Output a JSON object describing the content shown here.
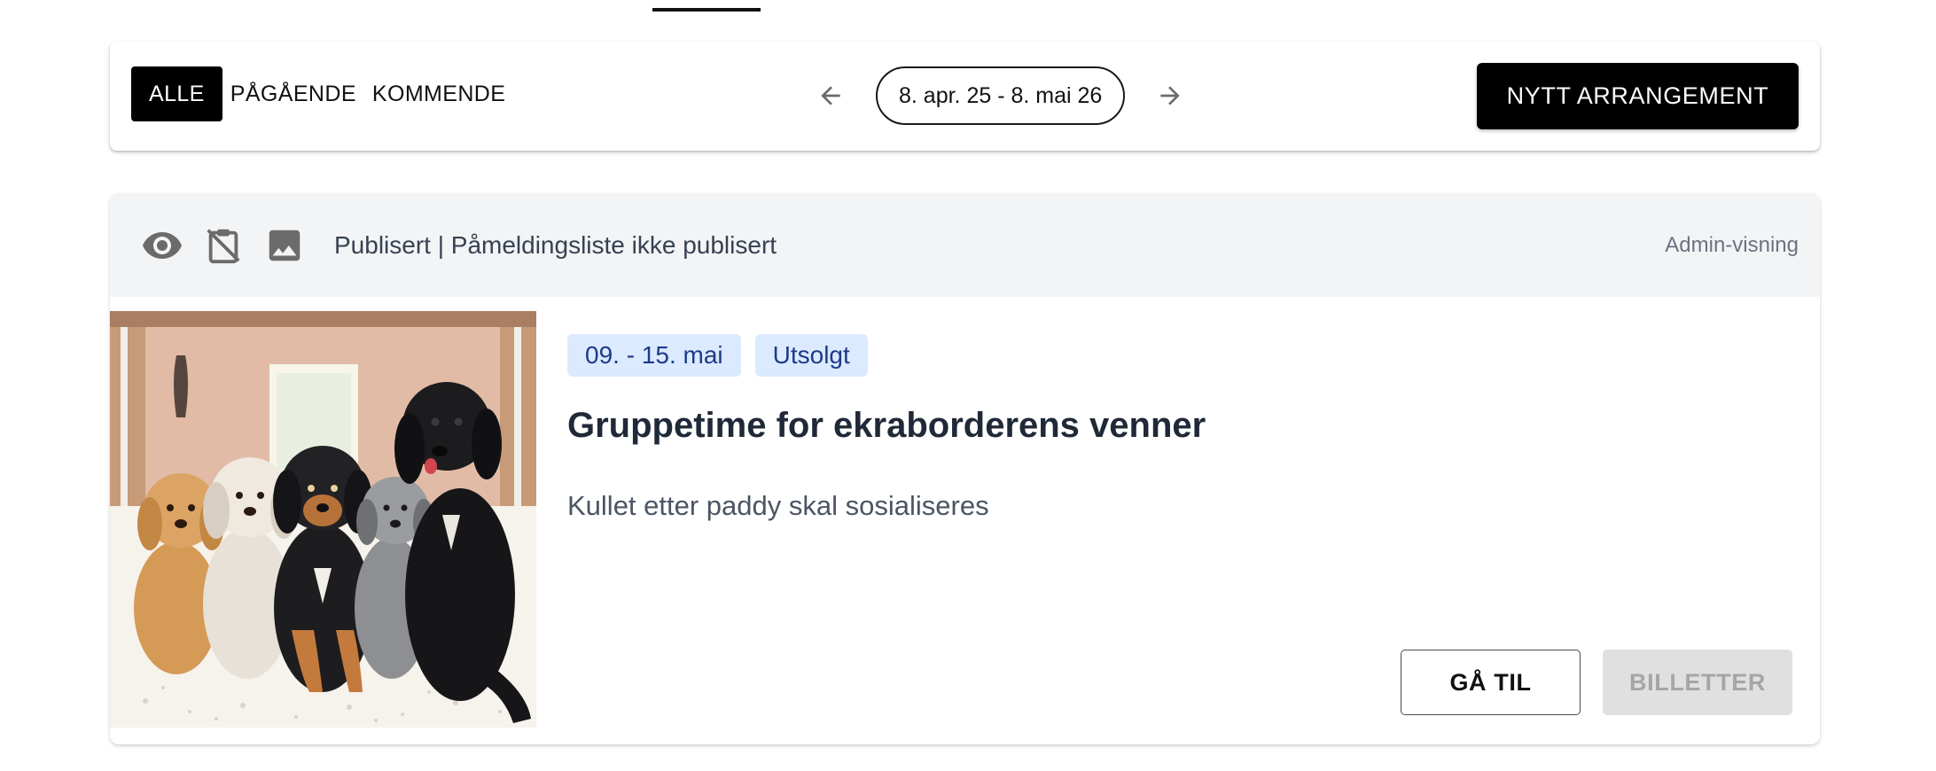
{
  "toolbar": {
    "filters": [
      {
        "label": "ALLE",
        "active": true
      },
      {
        "label": "PÅGÅENDE",
        "active": false
      },
      {
        "label": "KOMMENDE",
        "active": false
      }
    ],
    "date_range": "8. apr. 25 - 8. mai 26",
    "new_event_label": "NYTT ARRANGEMENT"
  },
  "event": {
    "status_text": "Publisert | Påmeldingsliste ikke publisert",
    "admin_view_label": "Admin-visning",
    "date_chip": "09. - 15. mai",
    "status_chip": "Utsolgt",
    "title": "Gruppetime for ekraborderens venner",
    "description": "Kullet etter paddy skal sosialiseres",
    "goto_label": "GÅ TIL",
    "tickets_label": "BILLETTER",
    "image_icon": "dogs-illustration"
  },
  "icons": {
    "prev": "arrow-left-icon",
    "next": "arrow-right-icon",
    "published": "eye-icon",
    "signup_list": "clipboard-off-icon",
    "image": "image-icon"
  },
  "colors": {
    "primary": "#000000",
    "chip_bg": "#dbeafe",
    "chip_text": "#1e3a8a",
    "admin_bar_bg": "#f3f4f6",
    "disabled_bg": "#e0e0e0"
  }
}
